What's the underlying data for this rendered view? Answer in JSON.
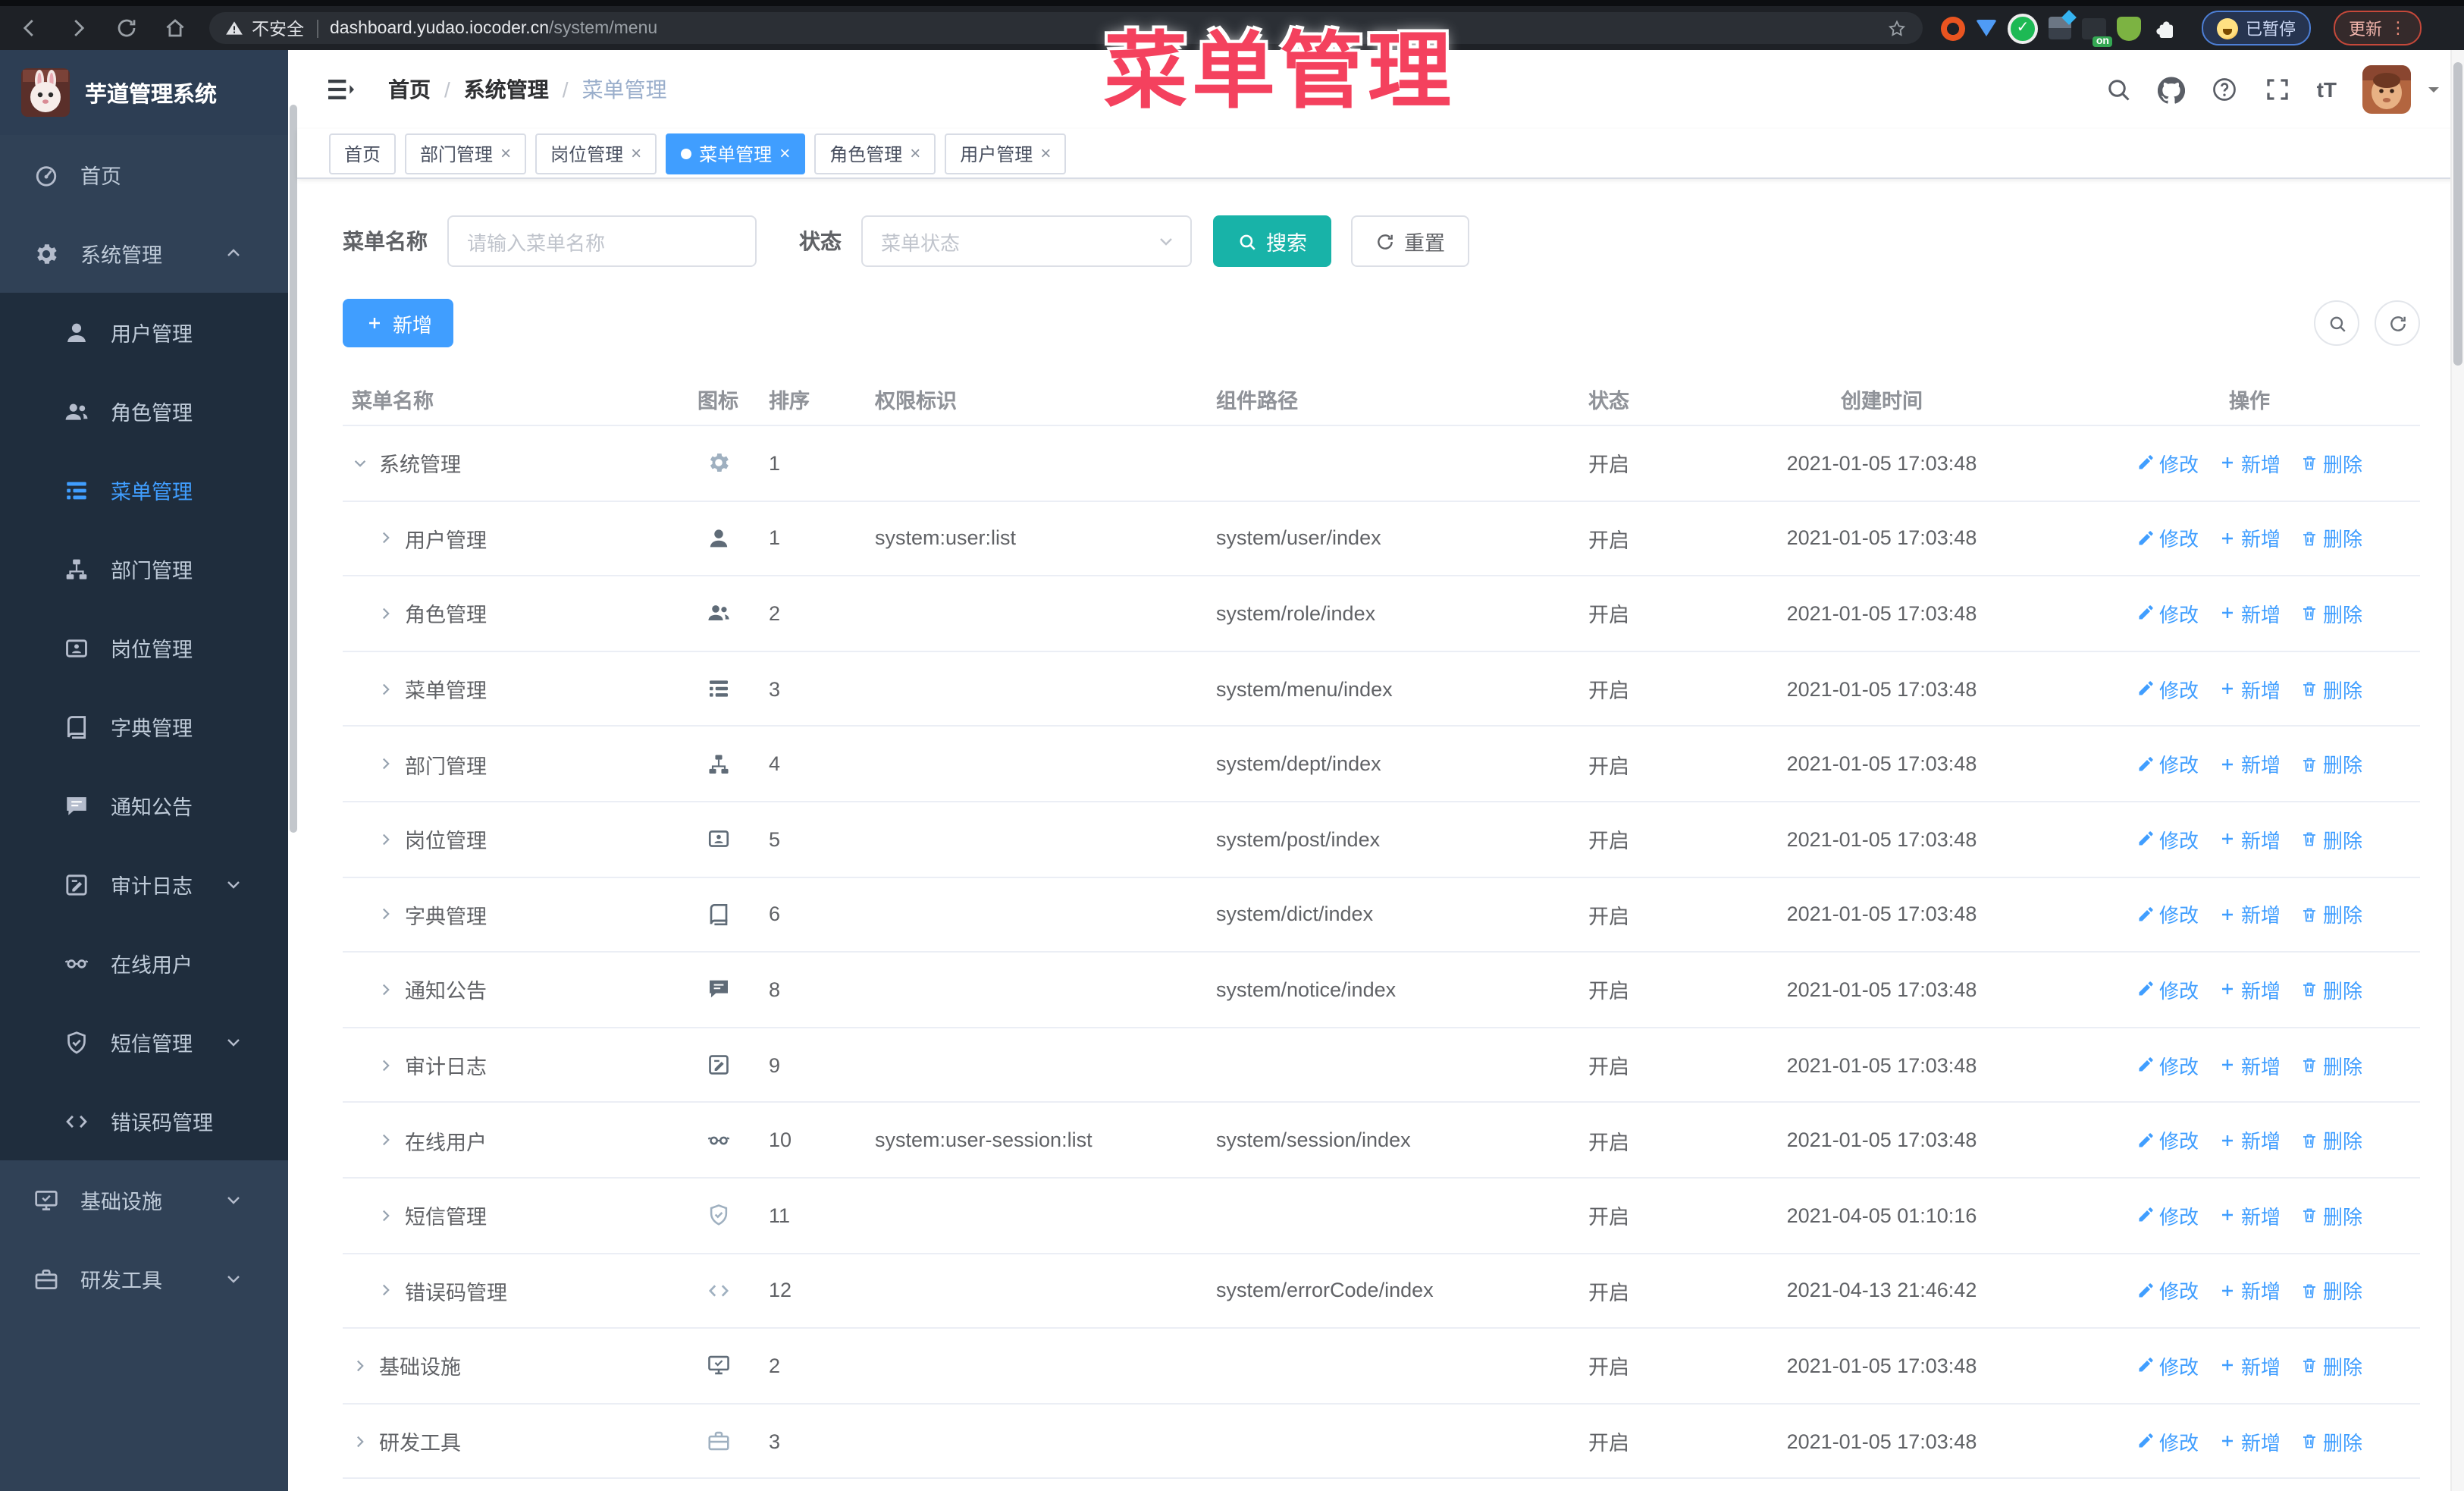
{
  "browser": {
    "security_label": "不安全",
    "url_host": "dashboard.yudao.iocoder.cn",
    "url_path": "/system/menu",
    "paused_badge": "已暂停",
    "update_button": "更新",
    "more_dots": "⋮"
  },
  "watermark": "菜单管理",
  "sidebar": {
    "logo_title": "芋道管理系统",
    "items": [
      {
        "label": "首页",
        "icon": "dashboard-icon",
        "level": "top"
      },
      {
        "label": "系统管理",
        "icon": "gear-icon",
        "level": "top",
        "arrow": "up"
      },
      {
        "label": "用户管理",
        "icon": "user-icon",
        "level": "sub"
      },
      {
        "label": "角色管理",
        "icon": "peoples-icon",
        "level": "sub"
      },
      {
        "label": "菜单管理",
        "icon": "tree-table-icon",
        "level": "sub",
        "active": true
      },
      {
        "label": "部门管理",
        "icon": "tree-icon",
        "level": "sub"
      },
      {
        "label": "岗位管理",
        "icon": "post-icon",
        "level": "sub"
      },
      {
        "label": "字典管理",
        "icon": "dict-icon",
        "level": "sub"
      },
      {
        "label": "通知公告",
        "icon": "message-icon",
        "level": "sub"
      },
      {
        "label": "审计日志",
        "icon": "form-icon",
        "level": "sub",
        "arrow": "down"
      },
      {
        "label": "在线用户",
        "icon": "online-icon",
        "level": "sub"
      },
      {
        "label": "短信管理",
        "icon": "shield-icon",
        "level": "sub",
        "arrow": "down"
      },
      {
        "label": "错误码管理",
        "icon": "code-icon",
        "level": "sub"
      },
      {
        "label": "基础设施",
        "icon": "monitor-icon",
        "level": "top",
        "arrow": "down"
      },
      {
        "label": "研发工具",
        "icon": "skill-icon",
        "level": "top",
        "arrow": "down"
      }
    ]
  },
  "header": {
    "breadcrumbs": [
      "首页",
      "系统管理",
      "菜单管理"
    ]
  },
  "tabs": [
    {
      "label": "首页",
      "closable": false,
      "active": false
    },
    {
      "label": "部门管理",
      "closable": true,
      "active": false
    },
    {
      "label": "岗位管理",
      "closable": true,
      "active": false
    },
    {
      "label": "菜单管理",
      "closable": true,
      "active": true
    },
    {
      "label": "角色管理",
      "closable": true,
      "active": false
    },
    {
      "label": "用户管理",
      "closable": true,
      "active": false
    }
  ],
  "filters": {
    "name_label": "菜单名称",
    "name_placeholder": "请输入菜单名称",
    "status_label": "状态",
    "status_placeholder": "菜单状态",
    "search_label": "搜索",
    "reset_label": "重置"
  },
  "toolbar": {
    "add_label": "新增"
  },
  "table": {
    "columns": [
      "菜单名称",
      "图标",
      "排序",
      "权限标识",
      "组件路径",
      "状态",
      "创建时间",
      "操作"
    ],
    "actions": [
      {
        "label": "修改",
        "icon": "edit-icon"
      },
      {
        "label": "新增",
        "icon": "plus-icon"
      },
      {
        "label": "删除",
        "icon": "delete-icon"
      }
    ],
    "rows": [
      {
        "name": "系统管理",
        "icon": "gear-icon",
        "icon_light": true,
        "caret": "down",
        "indent": 0,
        "order": "1",
        "perm": "",
        "path": "",
        "status": "开启",
        "time": "2021-01-05 17:03:48"
      },
      {
        "name": "用户管理",
        "icon": "user-icon",
        "icon_light": false,
        "caret": "right",
        "indent": 1,
        "order": "1",
        "perm": "system:user:list",
        "path": "system/user/index",
        "status": "开启",
        "time": "2021-01-05 17:03:48"
      },
      {
        "name": "角色管理",
        "icon": "peoples-icon",
        "icon_light": false,
        "caret": "right",
        "indent": 1,
        "order": "2",
        "perm": "",
        "path": "system/role/index",
        "status": "开启",
        "time": "2021-01-05 17:03:48"
      },
      {
        "name": "菜单管理",
        "icon": "tree-table-icon",
        "icon_light": false,
        "caret": "right",
        "indent": 1,
        "order": "3",
        "perm": "",
        "path": "system/menu/index",
        "status": "开启",
        "time": "2021-01-05 17:03:48"
      },
      {
        "name": "部门管理",
        "icon": "tree-icon",
        "icon_light": false,
        "caret": "right",
        "indent": 1,
        "order": "4",
        "perm": "",
        "path": "system/dept/index",
        "status": "开启",
        "time": "2021-01-05 17:03:48"
      },
      {
        "name": "岗位管理",
        "icon": "post-icon",
        "icon_light": false,
        "caret": "right",
        "indent": 1,
        "order": "5",
        "perm": "",
        "path": "system/post/index",
        "status": "开启",
        "time": "2021-01-05 17:03:48"
      },
      {
        "name": "字典管理",
        "icon": "dict-icon",
        "icon_light": false,
        "caret": "right",
        "indent": 1,
        "order": "6",
        "perm": "",
        "path": "system/dict/index",
        "status": "开启",
        "time": "2021-01-05 17:03:48"
      },
      {
        "name": "通知公告",
        "icon": "message-icon",
        "icon_light": false,
        "caret": "right",
        "indent": 1,
        "order": "8",
        "perm": "",
        "path": "system/notice/index",
        "status": "开启",
        "time": "2021-01-05 17:03:48"
      },
      {
        "name": "审计日志",
        "icon": "form-icon",
        "icon_light": false,
        "caret": "right",
        "indent": 1,
        "order": "9",
        "perm": "",
        "path": "",
        "status": "开启",
        "time": "2021-01-05 17:03:48"
      },
      {
        "name": "在线用户",
        "icon": "online-icon",
        "icon_light": false,
        "caret": "right",
        "indent": 1,
        "order": "10",
        "perm": "system:user-session:list",
        "path": "system/session/index",
        "status": "开启",
        "time": "2021-01-05 17:03:48"
      },
      {
        "name": "短信管理",
        "icon": "shield-icon",
        "icon_light": true,
        "caret": "right",
        "indent": 1,
        "order": "11",
        "perm": "",
        "path": "",
        "status": "开启",
        "time": "2021-04-05 01:10:16"
      },
      {
        "name": "错误码管理",
        "icon": "code-icon",
        "icon_light": true,
        "caret": "right",
        "indent": 1,
        "order": "12",
        "perm": "",
        "path": "system/errorCode/index",
        "status": "开启",
        "time": "2021-04-13 21:46:42"
      },
      {
        "name": "基础设施",
        "icon": "monitor-icon",
        "icon_light": false,
        "caret": "right",
        "indent": 0,
        "order": "2",
        "perm": "",
        "path": "",
        "status": "开启",
        "time": "2021-01-05 17:03:48"
      },
      {
        "name": "研发工具",
        "icon": "skill-icon",
        "icon_light": true,
        "caret": "right",
        "indent": 0,
        "order": "3",
        "perm": "",
        "path": "",
        "status": "开启",
        "time": "2021-01-05 17:03:48"
      }
    ]
  },
  "colors": {
    "accent_blue": "#409eff",
    "search_teal": "#18b3a8",
    "watermark_pink": "#f4415e",
    "sidebar_bg": "#304156",
    "submenu_bg": "#1f2d3d"
  }
}
